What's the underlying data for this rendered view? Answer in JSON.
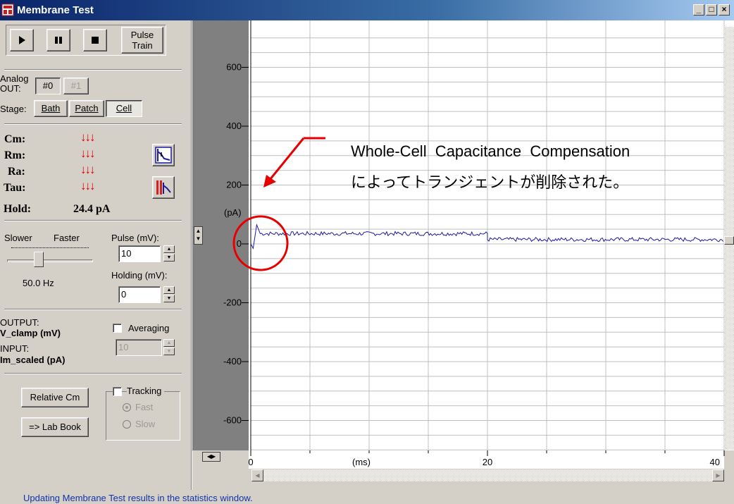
{
  "window": {
    "title": "Membrane Test",
    "buttons": [
      "_",
      "□",
      "×"
    ]
  },
  "toolbar": {
    "play_icon": "play-icon",
    "pause_icon": "pause-icon",
    "stop_icon": "stop-icon",
    "pulse_train_line1": "Pulse",
    "pulse_train_line2": "Train"
  },
  "analog_out": {
    "label_line1": "Analog",
    "label_line2": "OUT:",
    "options": [
      "#0",
      "#1"
    ],
    "selected": "#0"
  },
  "stage": {
    "label": "Stage:",
    "options": [
      "Bath",
      "Patch",
      "Cell"
    ],
    "selected": "Cell"
  },
  "params": {
    "cm_label": "Cm:",
    "rm_label": "Rm:",
    "ra_label": "Ra:",
    "tau_label": "Tau:",
    "arrows": "↓↓↓",
    "hold_label": "Hold:",
    "hold_value": "24.4 pA"
  },
  "rate": {
    "slower": "Slower",
    "faster": "Faster",
    "value": "50.0 Hz",
    "slider_level": 0.35
  },
  "pulse": {
    "label": "Pulse (mV):",
    "value": "10",
    "holding_label": "Holding (mV):",
    "holding_value": "0"
  },
  "io": {
    "output_label": "OUTPUT:",
    "output_value": "V_clamp (mV)",
    "input_label": "INPUT:",
    "input_value": "Im_scaled (pA)",
    "averaging_label": "Averaging",
    "averaging_value": "10"
  },
  "tracking": {
    "relative_cm": "Relative Cm",
    "lab_book": "=> Lab Book",
    "tracking_label": "Tracking",
    "fast": "Fast",
    "slow": "Slow"
  },
  "annotation": {
    "line1": "Whole-Cell  Capacitance  Compensation",
    "line2": "によってトランジェントが削除された。"
  },
  "status": {
    "text": "Updating Membrane Test results in the statistics window."
  },
  "chart_data": {
    "type": "line",
    "ylabel": "(pA)",
    "xlabel": "(ms)",
    "y_ticks": [
      600,
      400,
      200,
      0,
      -200,
      -400,
      -600
    ],
    "x_ticks": [
      0,
      20,
      40
    ],
    "xlim": [
      0,
      40
    ],
    "ylim": [
      -700,
      720
    ],
    "grid": true,
    "series": [
      {
        "color": "#1a1aa0",
        "segments": [
          {
            "x_start": 0,
            "x_end": 20,
            "level": 35
          },
          {
            "x_start": 20,
            "x_end": 40,
            "level": 15
          }
        ],
        "spike_at": 0.5,
        "spike_peak": 65
      }
    ]
  },
  "colors": {
    "trace": "#1a1aa0",
    "annotation_red": "#e60000",
    "status_text": "#1034a8",
    "title_bar": "#0a246a"
  }
}
